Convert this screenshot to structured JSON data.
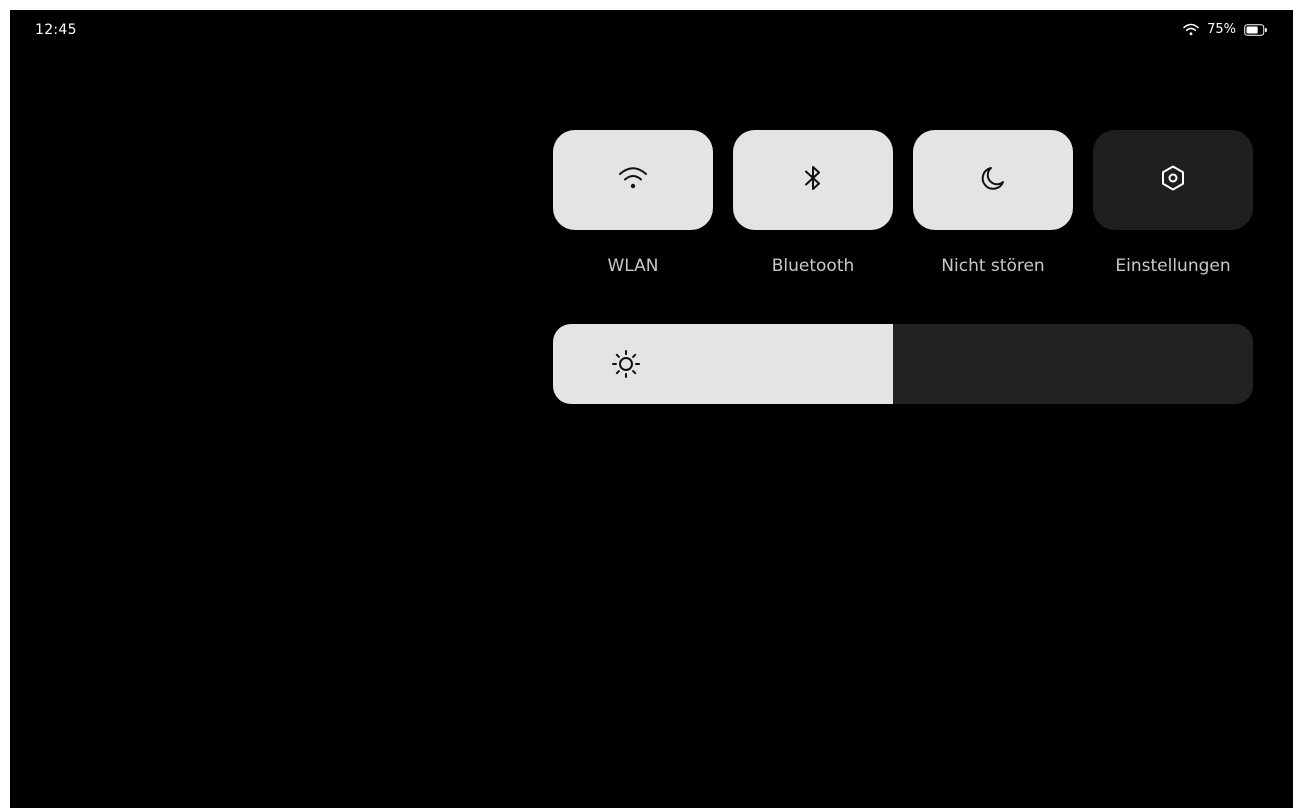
{
  "status_bar": {
    "time": "12:45",
    "battery_percent": "75%",
    "wifi_icon": "wifi-icon",
    "battery_icon": "battery-icon"
  },
  "quick_tiles": [
    {
      "label": "WLAN",
      "icon": "wifi-icon",
      "state": "on"
    },
    {
      "label": "Bluetooth",
      "icon": "bluetooth-icon",
      "state": "on"
    },
    {
      "label": "Nicht stören",
      "icon": "moon-icon",
      "state": "on"
    },
    {
      "label": "Einstellungen",
      "icon": "settings-icon",
      "state": "off"
    }
  ],
  "brightness": {
    "icon": "sun-icon",
    "level": 0.485
  },
  "colors": {
    "background": "#000000",
    "tile_on": "#e4e4e4",
    "tile_off": "#1f1f21",
    "label": "#c8c8c8"
  }
}
